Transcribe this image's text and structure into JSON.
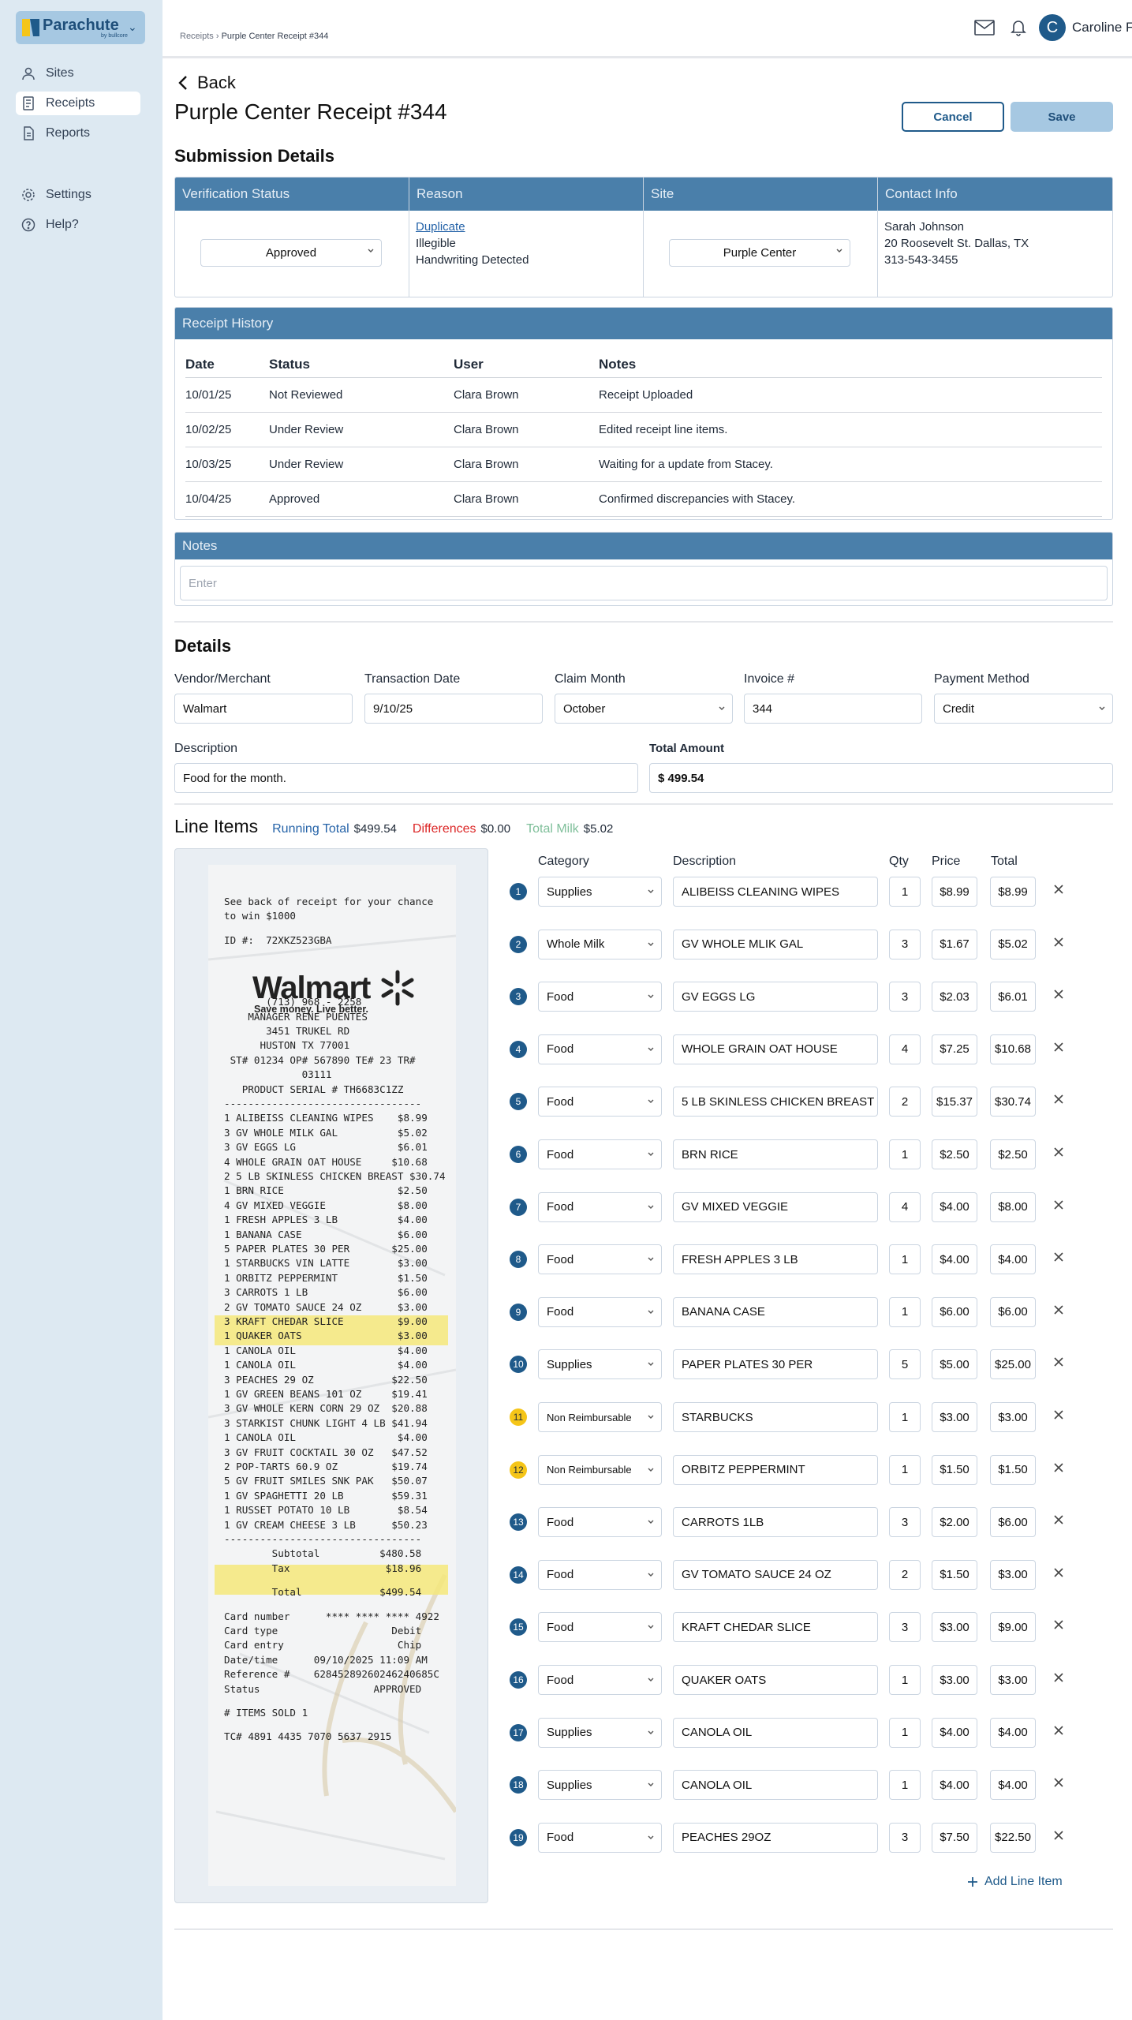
{
  "brand": {
    "name": "Parachute",
    "sub": "by bullcore"
  },
  "sidebar": {
    "items": [
      {
        "label": "Sites",
        "icon": "user-icon"
      },
      {
        "label": "Receipts",
        "icon": "receipt-icon"
      },
      {
        "label": "Reports",
        "icon": "document-icon"
      },
      {
        "label": "Settings",
        "icon": "gear-icon"
      },
      {
        "label": "Help?",
        "icon": "help-icon"
      }
    ]
  },
  "breadcrumb": {
    "parent": "Receipts",
    "current": "Purple Center Receipt #344"
  },
  "user": {
    "initial": "C",
    "name": "Caroline F"
  },
  "page": {
    "back": "Back",
    "title": "Purple Center Receipt #344",
    "cancel": "Cancel",
    "save": "Save"
  },
  "submission": {
    "title": "Submission Details",
    "headers": [
      "Verification Status",
      "Reason",
      "Site",
      "Contact Info"
    ],
    "status": "Approved",
    "reasons": [
      "Duplicate",
      "Illegible",
      "Handwriting Detected"
    ],
    "site": "Purple Center",
    "contact": [
      "Sarah Johnson",
      "20 Roosevelt St. Dallas, TX",
      "313-543-3455"
    ]
  },
  "history": {
    "title": "Receipt History",
    "columns": [
      "Date",
      "Status",
      "User",
      "Notes"
    ],
    "rows": [
      [
        "10/01/25",
        "Not Reviewed",
        "Clara Brown",
        "Receipt Uploaded"
      ],
      [
        "10/02/25",
        "Under Review",
        "Clara Brown",
        "Edited receipt line items."
      ],
      [
        "10/03/25",
        "Under Review",
        "Clara Brown",
        "Waiting for a update from Stacey."
      ],
      [
        "10/04/25",
        "Approved",
        "Clara Brown",
        "Confirmed discrepancies with Stacey."
      ]
    ]
  },
  "notes": {
    "title": "Notes",
    "placeholder": "Enter"
  },
  "details": {
    "title": "Details",
    "vendor_label": "Vendor/Merchant",
    "vendor": "Walmart",
    "date_label": "Transaction Date",
    "date": "9/10/25",
    "month_label": "Claim Month",
    "month": "October",
    "invoice_label": "Invoice #",
    "invoice": "344",
    "payment_label": "Payment Method",
    "payment": "Credit",
    "desc_label": "Description",
    "desc": "Food for the month.",
    "amount_label": "Total Amount",
    "amount": "$ 499.54"
  },
  "line_items": {
    "title": "Line Items",
    "running_label": "Running Total",
    "running": "$499.54",
    "diff_label": "Differences",
    "diff": "$0.00",
    "milk_label": "Total Milk",
    "milk": "$5.02",
    "columns": [
      "Category",
      "Description",
      "Qty",
      "Price",
      "Total"
    ],
    "add": "Add Line Item",
    "rows": [
      {
        "n": "1",
        "cat": "Supplies",
        "desc": "ALIBEISS CLEANING WIPES",
        "qty": "1",
        "price": "$8.99",
        "total": "$8.99"
      },
      {
        "n": "2",
        "cat": "Whole Milk",
        "desc": "GV WHOLE MLIK GAL",
        "qty": "3",
        "price": "$1.67",
        "total": "$5.02"
      },
      {
        "n": "3",
        "cat": "Food",
        "desc": "GV EGGS  LG",
        "qty": "3",
        "price": "$2.03",
        "total": "$6.01"
      },
      {
        "n": "4",
        "cat": "Food",
        "desc": "WHOLE GRAIN OAT HOUSE",
        "qty": "4",
        "price": "$7.25",
        "total": "$10.68"
      },
      {
        "n": "5",
        "cat": "Food",
        "desc": "5 LB SKINLESS CHICKEN BREAST",
        "qty": "2",
        "price": "$15.37",
        "total": "$30.74"
      },
      {
        "n": "6",
        "cat": "Food",
        "desc": "BRN RICE",
        "qty": "1",
        "price": "$2.50",
        "total": "$2.50"
      },
      {
        "n": "7",
        "cat": "Food",
        "desc": "GV MIXED VEGGIE",
        "qty": "4",
        "price": "$4.00",
        "total": "$8.00"
      },
      {
        "n": "8",
        "cat": "Food",
        "desc": "FRESH APPLES 3 LB",
        "qty": "1",
        "price": "$4.00",
        "total": "$4.00"
      },
      {
        "n": "9",
        "cat": "Food",
        "desc": "BANANA CASE",
        "qty": "1",
        "price": "$6.00",
        "total": "$6.00"
      },
      {
        "n": "10",
        "cat": "Supplies",
        "desc": "PAPER PLATES 30 PER",
        "qty": "5",
        "price": "$5.00",
        "total": "$25.00"
      },
      {
        "n": "11",
        "cat": "Non Reimbursable",
        "desc": "STARBUCKS",
        "qty": "1",
        "price": "$3.00",
        "total": "$3.00",
        "flag": true
      },
      {
        "n": "12",
        "cat": "Non Reimbursable",
        "desc": "ORBITZ PEPPERMINT",
        "qty": "1",
        "price": "$1.50",
        "total": "$1.50",
        "flag": true
      },
      {
        "n": "13",
        "cat": "Food",
        "desc": "CARROTS 1LB",
        "qty": "3",
        "price": "$2.00",
        "total": "$6.00"
      },
      {
        "n": "14",
        "cat": "Food",
        "desc": "GV TOMATO SAUCE 24 OZ",
        "qty": "2",
        "price": "$1.50",
        "total": "$3.00"
      },
      {
        "n": "15",
        "cat": "Food",
        "desc": "KRAFT CHEDAR SLICE",
        "qty": "3",
        "price": "$3.00",
        "total": "$9.00"
      },
      {
        "n": "16",
        "cat": "Food",
        "desc": "QUAKER OATS",
        "qty": "1",
        "price": "$3.00",
        "total": "$3.00"
      },
      {
        "n": "17",
        "cat": "Supplies",
        "desc": "CANOLA OIL",
        "qty": "1",
        "price": "$4.00",
        "total": "$4.00"
      },
      {
        "n": "18",
        "cat": "Supplies",
        "desc": "CANOLA OIL",
        "qty": "1",
        "price": "$4.00",
        "total": "$4.00"
      },
      {
        "n": "19",
        "cat": "Food",
        "desc": "PEACHES 29OZ",
        "qty": "3",
        "price": "$7.50",
        "total": "$22.50"
      }
    ]
  },
  "receipt": {
    "walmart": "Walmart",
    "tagline": "Save money. Live better.",
    "lines": [
      "See back of receipt for your chance",
      "to win $1000",
      "",
      "ID #:  72XKZ523GBA",
      "",
      "",
      "",
      "",
      "",
      "       (713) 968 - 2258",
      "    MANAGER RENE PUENTES",
      "       3451 TRUKEL RD",
      "      HUSTON TX 77001",
      " ST# 01234 OP# 567890 TE# 23 TR#",
      "             03111",
      "   PRODUCT SERIAL # TH6683C1ZZ",
      "---------------------------------",
      "1 ALIBEISS CLEANING WIPES    $8.99",
      "3 GV WHOLE MILK GAL          $5.02",
      "3 GV EGGS LG                 $6.01",
      "4 WHOLE GRAIN OAT HOUSE     $10.68",
      "2 5 LB SKINLESS CHICKEN BREAST $30.74",
      "1 BRN RICE                   $2.50",
      "4 GV MIXED VEGGIE            $8.00",
      "1 FRESH APPLES 3 LB          $4.00",
      "1 BANANA CASE                $6.00",
      "5 PAPER PLATES 30 PER       $25.00",
      "1 STARBUCKS VIN LATTE        $3.00",
      "1 ORBITZ PEPPERMINT          $1.50",
      "3 CARROTS 1 LB               $6.00",
      "2 GV TOMATO SAUCE 24 OZ      $3.00",
      "3 KRAFT CHEDAR SLICE         $9.00",
      "1 QUAKER OATS                $3.00",
      "1 CANOLA OIL                 $4.00",
      "1 CANOLA OIL                 $4.00",
      "3 PEACHES 29 OZ             $22.50",
      "1 GV GREEN BEANS 101 OZ     $19.41",
      "3 GV WHOLE KERN CORN 29 OZ  $20.88",
      "3 STARKIST CHUNK LIGHT 4 LB $41.94",
      "1 CANOLA OIL                 $4.00",
      "3 GV FRUIT COCKTAIL 30 OZ   $47.52",
      "2 POP-TARTS 60.9 OZ         $19.74",
      "5 GV FRUIT SMILES SNK PAK   $50.07",
      "1 GV SPAGHETTI 20 LB        $59.31",
      "1 RUSSET POTATO 10 LB        $8.54",
      "1 GV CREAM CHEESE 3 LB      $50.23",
      "---------------------------------",
      "        Subtotal          $480.58",
      "        Tax                $18.96",
      "",
      "        Total             $499.54",
      "",
      "Card number      **** **** **** 4922",
      "Card type                   Debit",
      "Card entry                   Chip",
      "Date/time      09/10/2025 11:09 AM",
      "Reference #    62845289260246240685C",
      "Status                   APPROVED",
      "",
      "# ITEMS SOLD 1",
      "",
      "TC# 4891 4435 7070 5637 2915"
    ]
  },
  "colors": {
    "accent": "#1f5a8a",
    "header": "#4a7faa",
    "running": "#2563a8",
    "diff": "#dc2626",
    "milk": "#7fbf9a",
    "flag": "#f5c518"
  }
}
